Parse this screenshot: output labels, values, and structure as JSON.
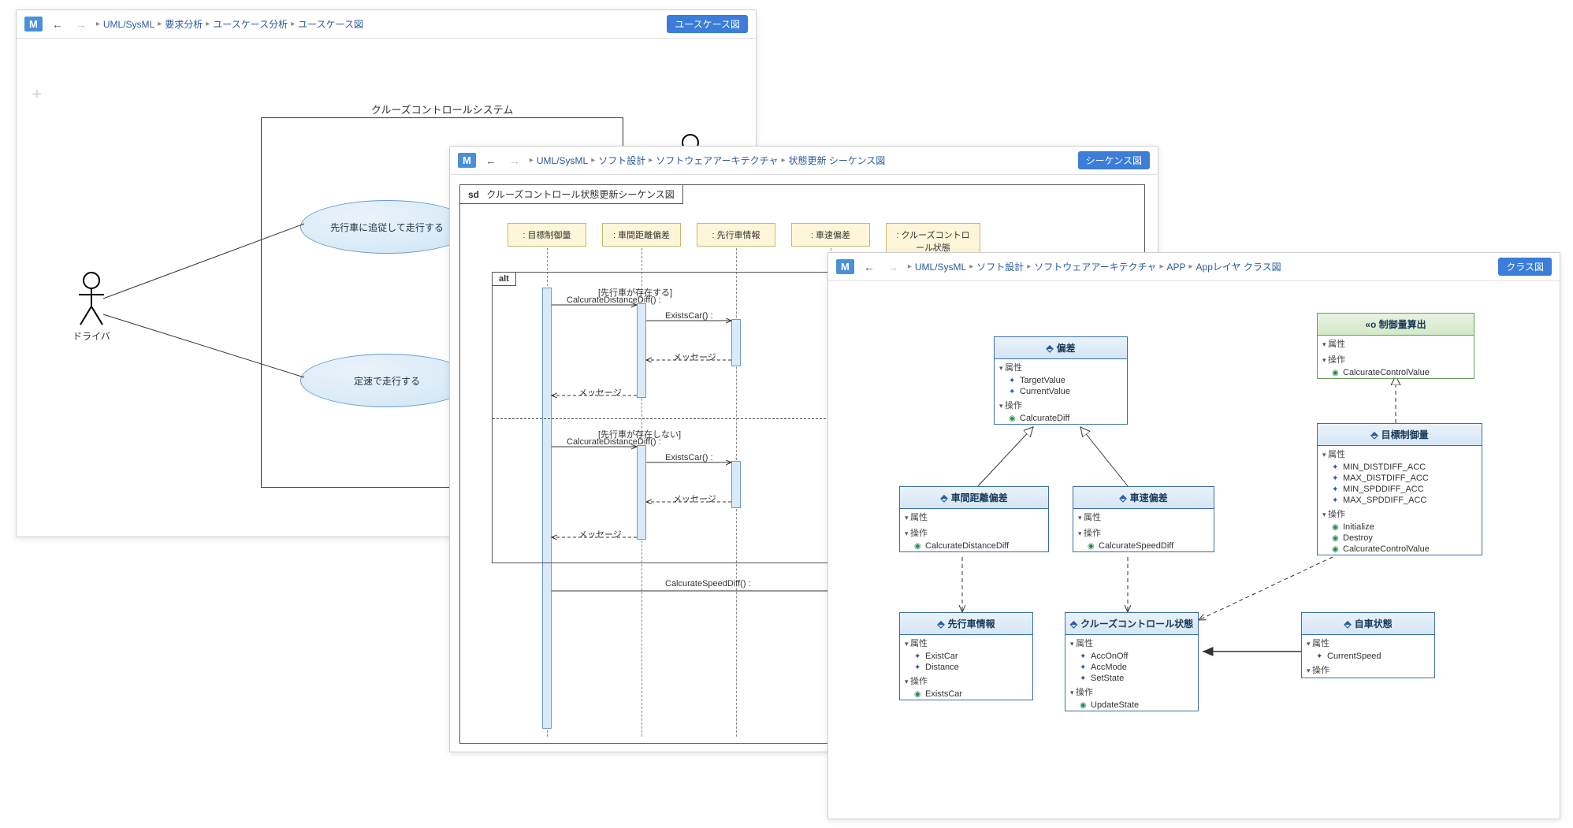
{
  "window1": {
    "badge": "M",
    "breadcrumb": [
      "UML/SysML",
      "要求分析",
      "ユースケース分析",
      "ユースケース図"
    ],
    "diagram_badge": "ユースケース図",
    "system_label": "クルーズコントロールシステム",
    "actor1": "ドライバ",
    "usecase1": "先行車に追従して走行する",
    "usecase2": "定速で走行する"
  },
  "window2": {
    "badge": "M",
    "breadcrumb": [
      "UML/SysML",
      "ソフト設計",
      "ソフトウェアアーキテクチャ",
      "状態更新 シーケンス図"
    ],
    "diagram_badge": "シーケンス図",
    "sd_kw": "sd",
    "sd_title": "クルーズコントロール状態更新シーケンス図",
    "lifelines": [
      ": 目標制御量",
      ": 車間距離偏差",
      ": 先行車情報",
      ": 車速偏差",
      ": クルーズコントロール状態"
    ],
    "alt": "alt",
    "guard1": "[先行車が存在する]",
    "guard2": "[先行車が存在しない]",
    "msg_calcdist": "CalcurateDistanceDiff() :",
    "msg_exists": "ExistsCar() :",
    "msg_generic": "メッセージ",
    "msg_calcspeed": "CalcurateSpeedDiff() :"
  },
  "window3": {
    "badge": "M",
    "breadcrumb": [
      "UML/SysML",
      "ソフト設計",
      "ソフトウェアアーキテクチャ",
      "APP",
      "Appレイヤ クラス図"
    ],
    "diagram_badge": "クラス図",
    "iface": {
      "name": "«o 制御量算出",
      "attrs_label": "属性",
      "ops_label": "操作",
      "ops": [
        "CalcurateControlValue"
      ]
    },
    "c_hensa": {
      "name": "偏差",
      "attrs_label": "属性",
      "ops_label": "操作",
      "attrs": [
        "TargetValue",
        "CurrentValue"
      ],
      "ops": [
        "CalcurateDiff"
      ]
    },
    "c_mokuhyou": {
      "name": "目標制御量",
      "attrs_label": "属性",
      "ops_label": "操作",
      "attrs": [
        "MIN_DISTDIFF_ACC",
        "MAX_DISTDIFF_ACC",
        "MIN_SPDDIFF_ACC",
        "MAX_SPDDIFF_ACC"
      ],
      "ops": [
        "Initialize",
        "Destroy",
        "CalcurateControlValue"
      ]
    },
    "c_shakan": {
      "name": "車間距離偏差",
      "attrs_label": "属性",
      "ops_label": "操作",
      "ops": [
        "CalcurateDistanceDiff"
      ]
    },
    "c_shasoku": {
      "name": "車速偏差",
      "attrs_label": "属性",
      "ops_label": "操作",
      "ops": [
        "CalcurateSpeedDiff"
      ]
    },
    "c_senkou": {
      "name": "先行車情報",
      "attrs_label": "属性",
      "ops_label": "操作",
      "attrs": [
        "ExistCar",
        "Distance"
      ],
      "ops": [
        "ExistsCar"
      ]
    },
    "c_cruise": {
      "name": "クルーズコントロール状態",
      "attrs_label": "属性",
      "ops_label": "操作",
      "attrs": [
        "AccOnOff",
        "AccMode",
        "SetState"
      ],
      "ops": [
        "UpdateState"
      ]
    },
    "c_jisha": {
      "name": "自車状態",
      "attrs_label": "属性",
      "ops_label": "操作",
      "attrs": [
        "CurrentSpeed"
      ]
    }
  }
}
